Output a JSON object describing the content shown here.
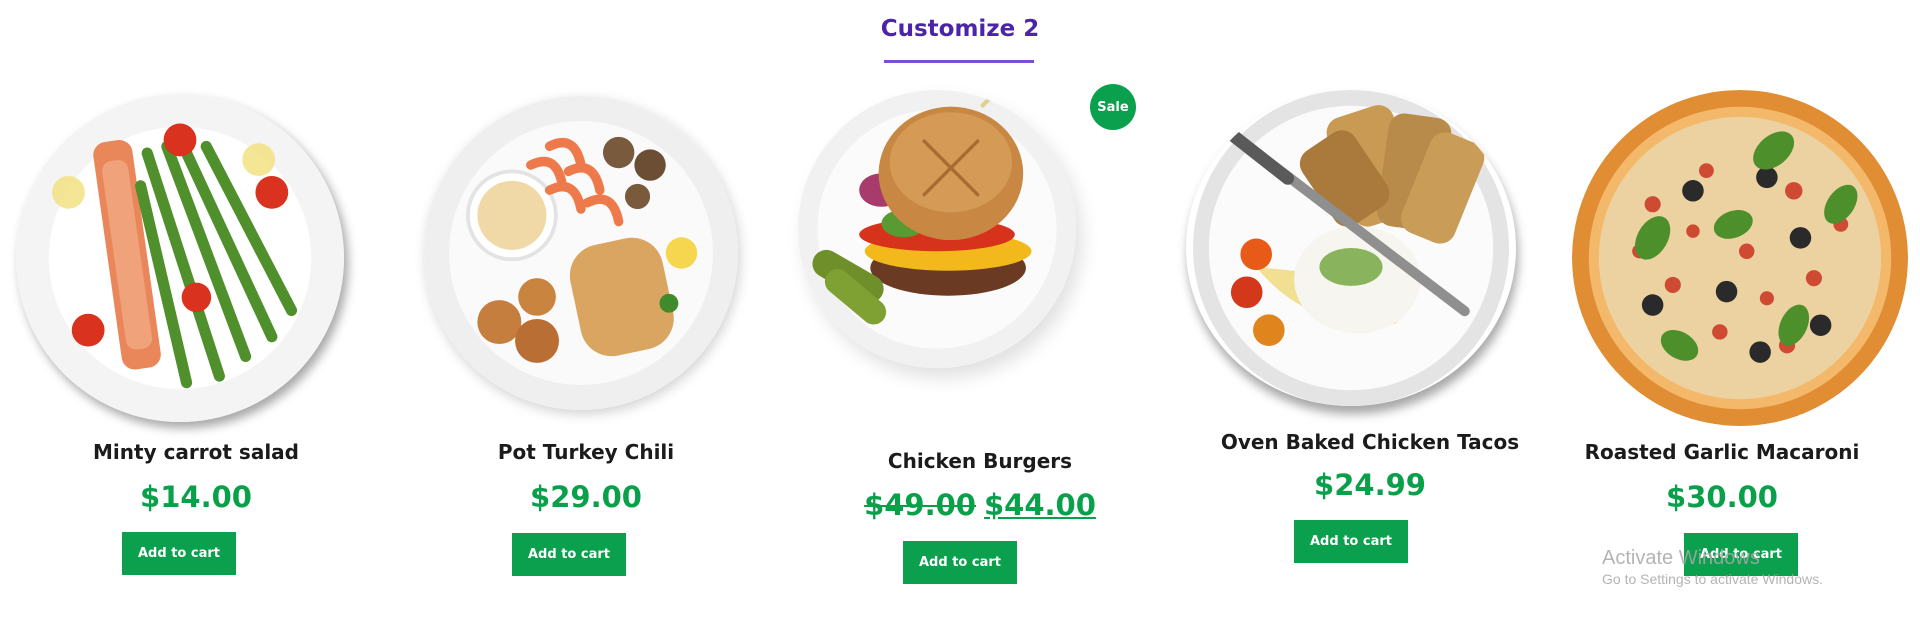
{
  "section": {
    "title": "Customize 2",
    "accent_color": "#4b24a8"
  },
  "colors": {
    "price_green": "#09a04a",
    "button_green": "#0aa04e"
  },
  "products": [
    {
      "name": "Minty carrot salad",
      "price": "$14.00",
      "button_label": "Add to cart",
      "image": "salmon-asparagus-plate"
    },
    {
      "name": "Pot Turkey Chili",
      "price": "$29.00",
      "button_label": "Add to cart",
      "image": "shrimp-fish-plate"
    },
    {
      "name": "Chicken Burgers",
      "old_price": "$49.00",
      "price": "$44.00",
      "badge": "Sale",
      "button_label": "Add to cart",
      "image": "burger-plate"
    },
    {
      "name": "Oven Baked Chicken Tacos",
      "price": "$24.99",
      "button_label": "Add to cart",
      "image": "burrata-bread-plate"
    },
    {
      "name": "Roasted Garlic Macaroni",
      "price": "$30.00",
      "button_label": "Add to cart",
      "image": "pizza"
    }
  ],
  "watermark": {
    "title": "Activate Windows",
    "subtitle": "Go to Settings to activate Windows."
  }
}
